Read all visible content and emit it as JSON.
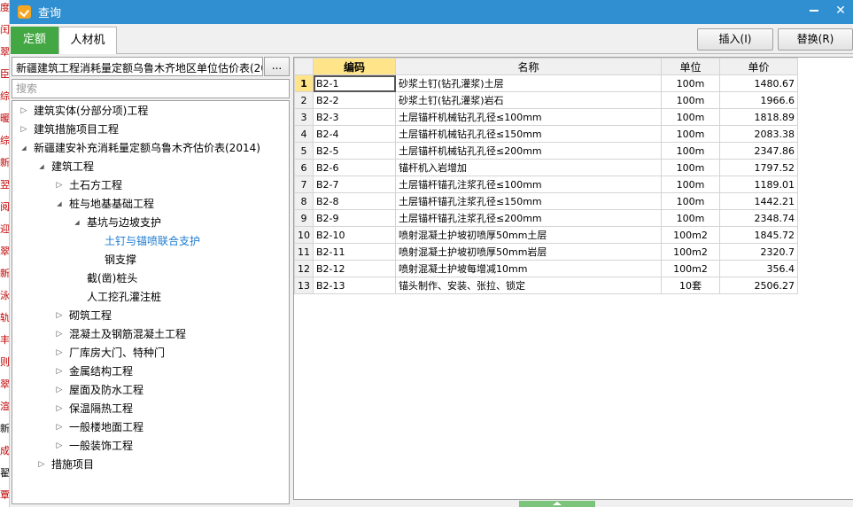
{
  "window": {
    "title": "查询",
    "minimize": "—",
    "close": "✕"
  },
  "background": {
    "strip_chars": [
      "度",
      "闰",
      "翠",
      "臣",
      "综",
      "暖",
      "综",
      "新",
      "翌",
      "阅",
      "迎",
      "翠",
      "新",
      "泳",
      "轨",
      "丰",
      "则",
      "翠",
      "渲",
      "新",
      "成",
      "翟",
      "覃"
    ]
  },
  "tabs": [
    {
      "label": "定额",
      "active": true
    },
    {
      "label": "人材机",
      "active": false
    }
  ],
  "toolbar": {
    "insert_label": "插入(I)",
    "replace_label": "替换(R)"
  },
  "library": {
    "selected": "新疆建筑工程消耗量定额乌鲁木齐地区单位估价表(20",
    "browse_label": "..."
  },
  "search": {
    "placeholder": "搜索",
    "value": ""
  },
  "tree": [
    {
      "label": "建筑实体(分部分项)工程",
      "level": 0,
      "arrow": "right"
    },
    {
      "label": "建筑措施项目工程",
      "level": 0,
      "arrow": "right"
    },
    {
      "label": "新疆建安补充消耗量定额乌鲁木齐估价表(2014)",
      "level": 0,
      "arrow": "down"
    },
    {
      "label": "建筑工程",
      "level": 1,
      "arrow": "down"
    },
    {
      "label": "土石方工程",
      "level": 2,
      "arrow": "right"
    },
    {
      "label": "桩与地基基础工程",
      "level": 2,
      "arrow": "down"
    },
    {
      "label": "基坑与边坡支护",
      "level": 3,
      "arrow": "down"
    },
    {
      "label": "土钉与锚喷联合支护",
      "level": 4,
      "arrow": "none",
      "selected": true
    },
    {
      "label": "钢支撑",
      "level": 4,
      "arrow": "none"
    },
    {
      "label": "截(凿)桩头",
      "level": 3,
      "arrow": "none"
    },
    {
      "label": "人工挖孔灌注桩",
      "level": 3,
      "arrow": "none"
    },
    {
      "label": "砌筑工程",
      "level": 2,
      "arrow": "right"
    },
    {
      "label": "混凝土及钢筋混凝土工程",
      "level": 2,
      "arrow": "right"
    },
    {
      "label": "厂库房大门、特种门",
      "level": 2,
      "arrow": "right"
    },
    {
      "label": "金属结构工程",
      "level": 2,
      "arrow": "right"
    },
    {
      "label": "屋面及防水工程",
      "level": 2,
      "arrow": "right"
    },
    {
      "label": "保温隔热工程",
      "level": 2,
      "arrow": "right"
    },
    {
      "label": "一般楼地面工程",
      "level": 2,
      "arrow": "right"
    },
    {
      "label": "一般装饰工程",
      "level": 2,
      "arrow": "right"
    },
    {
      "label": "措施项目",
      "level": 1,
      "arrow": "right"
    }
  ],
  "table": {
    "headers": [
      "编码",
      "名称",
      "单位",
      "单价"
    ],
    "rows": [
      {
        "n": "1",
        "code": "B2-1",
        "name": "砂浆土钉(钻孔灌浆)土层",
        "unit": "100m",
        "price": "1480.67"
      },
      {
        "n": "2",
        "code": "B2-2",
        "name": "砂浆土钉(钻孔灌浆)岩石",
        "unit": "100m",
        "price": "1966.6"
      },
      {
        "n": "3",
        "code": "B2-3",
        "name": "土层锚杆机械钻孔孔径≤100mm",
        "unit": "100m",
        "price": "1818.89"
      },
      {
        "n": "4",
        "code": "B2-4",
        "name": "土层锚杆机械钻孔孔径≤150mm",
        "unit": "100m",
        "price": "2083.38"
      },
      {
        "n": "5",
        "code": "B2-5",
        "name": "土层锚杆机械钻孔孔径≤200mm",
        "unit": "100m",
        "price": "2347.86"
      },
      {
        "n": "6",
        "code": "B2-6",
        "name": "锚杆机入岩增加",
        "unit": "100m",
        "price": "1797.52"
      },
      {
        "n": "7",
        "code": "B2-7",
        "name": "土层锚杆锚孔注浆孔径≤100mm",
        "unit": "100m",
        "price": "1189.01"
      },
      {
        "n": "8",
        "code": "B2-8",
        "name": "土层锚杆锚孔注浆孔径≤150mm",
        "unit": "100m",
        "price": "1442.21"
      },
      {
        "n": "9",
        "code": "B2-9",
        "name": "土层锚杆锚孔注浆孔径≤200mm",
        "unit": "100m",
        "price": "2348.74"
      },
      {
        "n": "10",
        "code": "B2-10",
        "name": "喷射混凝土护坡初喷厚50mm土层",
        "unit": "100m2",
        "price": "1845.72"
      },
      {
        "n": "11",
        "code": "B2-11",
        "name": "喷射混凝土护坡初喷厚50mm岩层",
        "unit": "100m2",
        "price": "2320.7"
      },
      {
        "n": "12",
        "code": "B2-12",
        "name": "喷射混凝土护坡每增减10mm",
        "unit": "100m2",
        "price": "356.4"
      },
      {
        "n": "13",
        "code": "B2-13",
        "name": "锚头制作、安装、张拉、锁定",
        "unit": "10套",
        "price": "2506.27"
      }
    ]
  }
}
